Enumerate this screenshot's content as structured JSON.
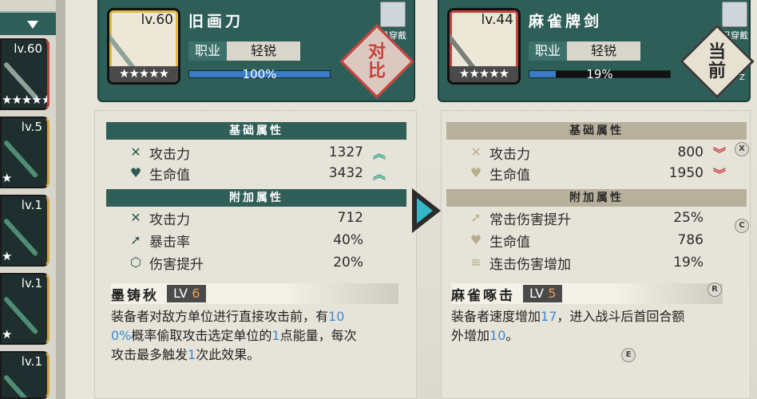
{
  "sidebar": {
    "slots": [
      {
        "level": "lv.60",
        "stars": "★★★★★"
      },
      {
        "level": "lv.5",
        "stars": "★"
      },
      {
        "level": "lv.1",
        "stars": "★"
      },
      {
        "level": "lv.1",
        "stars": "★"
      },
      {
        "level": "lv.1",
        "stars": "★"
      }
    ]
  },
  "left_weapon": {
    "level": "lv.60",
    "stars": "★★★★★",
    "name": "旧画刀",
    "job_label": "职业",
    "job_value": "轻锐",
    "exp_percent": 100,
    "exp_text": "100%",
    "owner_label": "已穿戴",
    "action_label_1": "对",
    "action_label_2": "比",
    "base_title": "基础属性",
    "base_stats": [
      {
        "name": "攻击力",
        "value": "1327",
        "trend": "up"
      },
      {
        "name": "生命值",
        "value": "3432",
        "trend": "up"
      }
    ],
    "extra_title": "附加属性",
    "extra_stats": [
      {
        "name": "攻击力",
        "value": "712"
      },
      {
        "name": "暴击率",
        "value": "40%"
      },
      {
        "name": "伤害提升",
        "value": "20%"
      }
    ],
    "skill_name": "墨铸秋",
    "skill_lv_prefix": "LV",
    "skill_lv": "6",
    "skill_desc_1a": "装备者对敌方单位进行直接攻击前，有",
    "skill_desc_1b": "10",
    "skill_desc_2a": "0%",
    "skill_desc_2b": "概率偷取攻击选定单位的",
    "skill_desc_2c": "1",
    "skill_desc_2d": "点能量，每次",
    "skill_desc_3a": "攻击最多触发",
    "skill_desc_3b": "1",
    "skill_desc_3c": "次此效果。"
  },
  "right_weapon": {
    "level": "lv.44",
    "stars": "★★★★★",
    "name": "麻雀牌剑",
    "job_label": "职业",
    "job_value": "轻锐",
    "exp_percent": 19,
    "exp_text": "19%",
    "owner_label": "已穿戴",
    "action_label_1": "当",
    "action_label_2": "前",
    "action_key": "Z",
    "base_title": "基础属性",
    "base_stats": [
      {
        "name": "攻击力",
        "value": "800",
        "trend": "down"
      },
      {
        "name": "生命值",
        "value": "1950",
        "trend": "down"
      }
    ],
    "extra_title": "附加属性",
    "extra_stats": [
      {
        "name": "常击伤害提升",
        "value": "25%"
      },
      {
        "name": "生命值",
        "value": "786"
      },
      {
        "name": "连击伤害增加",
        "value": "19%"
      }
    ],
    "skill_name": "麻雀啄击",
    "skill_lv_prefix": "LV",
    "skill_lv": "5",
    "skill_desc_1a": "装备者速度增加",
    "skill_desc_1b": "17",
    "skill_desc_1c": "，进入战斗后首回合额",
    "skill_desc_2a": "外增加",
    "skill_desc_2b": "10",
    "skill_desc_2c": "。"
  },
  "keys": {
    "x": "X",
    "c": "C",
    "r": "R",
    "e": "E"
  },
  "colors": {
    "teal": "#2e5e58",
    "gold": "#e0b941",
    "red": "#c7413c",
    "blue": "#3b8ad4",
    "up": "#3aa88a"
  },
  "icons": [
    "swords-icon",
    "heart-icon",
    "crit-arrow-icon",
    "shield-gear-icon",
    "wave-icon",
    "play-arrow-icon",
    "chevron-up-double-icon",
    "chevron-down-double-icon"
  ]
}
